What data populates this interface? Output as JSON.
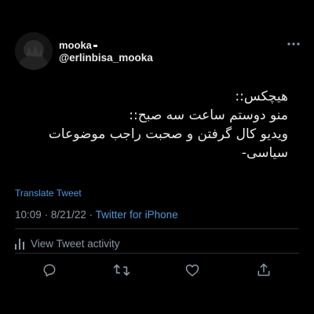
{
  "user": {
    "display_name": "mooka",
    "handle": "@erlinbisa_mooka"
  },
  "tweet": {
    "lines": [
      "هیچکس::",
      "منو دوستم ساعت سه صبح::",
      "ویدیو کال گرفتن و صحبت راجب موضوعات",
      "سیاسی-"
    ],
    "translate_label": "Translate Tweet",
    "time": "10:09",
    "date": "8/21/22",
    "separator": "·",
    "source": "Twitter for iPhone"
  },
  "activity": {
    "label": "View Tweet activity"
  },
  "colors": {
    "background": "#000000",
    "text": "#e7e9ea",
    "muted": "#8b98a5",
    "link": "#4f98da",
    "divider": "#2a2d30"
  },
  "icons": {
    "more": "more-dots-icon",
    "activity": "bar-chart-icon",
    "reply": "reply-icon",
    "retweet": "retweet-icon",
    "like": "heart-icon",
    "share": "share-icon"
  }
}
